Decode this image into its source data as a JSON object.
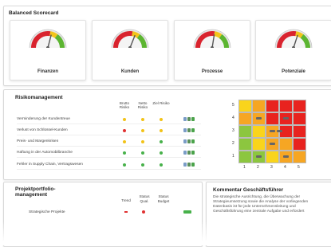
{
  "scorecard": {
    "title": "Balanced Scorecard",
    "gauges": [
      {
        "label": "Finanzen",
        "value": 0.58
      },
      {
        "label": "Kunden",
        "value": 0.62
      },
      {
        "label": "Prozesse",
        "value": 0.55
      },
      {
        "label": "Potenziale",
        "value": 0.6
      }
    ],
    "gauge_colors": {
      "red": "#d9232e",
      "yellow": "#f3c51a",
      "green": "#5cb531",
      "needle": "#555555"
    }
  },
  "risk": {
    "title": "Risikomanagement",
    "headers": [
      "Brutto Risiko",
      "Netto Risiko",
      "Ziel Risiko"
    ],
    "rows": [
      {
        "label": "Verminderung der Kundentreue",
        "dots": [
          "yellow",
          "yellow",
          "yellow"
        ]
      },
      {
        "label": "Verlust von Schlüssel-Kunden",
        "dots": [
          "red",
          "yellow",
          "yellow"
        ]
      },
      {
        "label": "Preis- und Margenkrisen",
        "dots": [
          "yellow",
          "yellow",
          "green"
        ]
      },
      {
        "label": "Haftung in der Automobilbranche",
        "dots": [
          "green",
          "green",
          "green"
        ]
      },
      {
        "label": "Fehler in Supply Chain, Vertragswesen",
        "dots": [
          "green",
          "green",
          "green"
        ]
      }
    ],
    "dot_colors": {
      "red": "#e03131",
      "yellow": "#f2c318",
      "green": "#47b14a"
    },
    "matrix": {
      "x_ticks": [
        "1",
        "2",
        "3",
        "4",
        "5"
      ],
      "y_ticks": [
        "5",
        "4",
        "3",
        "2",
        "1"
      ],
      "colors": {
        "red": "#e8231f",
        "orange": "#f6a623",
        "yellow": "#f9d41c",
        "green": "#8cc63f"
      }
    }
  },
  "portfolio": {
    "title": "Projektportfolio-management",
    "headers": [
      "Trend",
      "Status Qual.",
      "Status Budget"
    ],
    "first_row": "Strategische Projekte"
  },
  "comment": {
    "title": "Kommentar Geschäftsführer",
    "text": "Die strategische Ausrichtung, die Überwachung der Strategieumsetzung sowie die Analyse der vorliegenden Datenbasis ist für jede Unternehmensleitung und Geschäftsführung eine zentrale Aufgabe und erfordert"
  }
}
